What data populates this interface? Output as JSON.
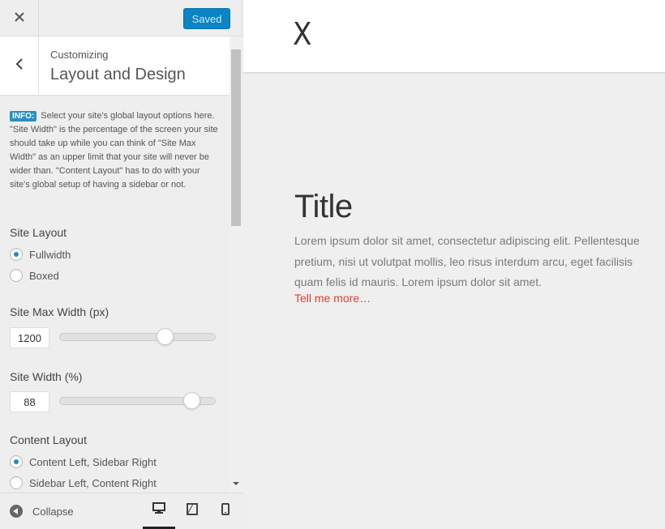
{
  "topbar": {
    "save_label": "Saved"
  },
  "section": {
    "parent_label": "Customizing",
    "title": "Layout and Design"
  },
  "info": {
    "badge": "INFO:",
    "text": "Select your site's global layout options here. \"Site Width\" is the percentage of the screen your site should take up while you can think of \"Site Max Width\" as an upper limit that your site will never be wider than. \"Content Layout\" has to do with your site's global setup of having a sidebar or not."
  },
  "site_layout": {
    "label": "Site Layout",
    "options": [
      "Fullwidth",
      "Boxed"
    ],
    "selected": "Fullwidth"
  },
  "site_max_width": {
    "label": "Site Max Width (px)",
    "value": "1200",
    "slider_fraction": 0.7
  },
  "site_width": {
    "label": "Site Width (%)",
    "value": "88",
    "slider_fraction": 0.89
  },
  "content_layout": {
    "label": "Content Layout",
    "options": [
      "Content Left, Sidebar Right",
      "Sidebar Left, Content Right"
    ],
    "selected": "Content Left, Sidebar Right"
  },
  "footer": {
    "collapse_label": "Collapse",
    "devices": [
      "desktop-icon",
      "tablet-icon",
      "mobile-icon"
    ],
    "active_device": "desktop"
  },
  "preview": {
    "logo": "X",
    "post_title": "Title",
    "post_body": "Lorem ipsum dolor sit amet, consectetur adipiscing elit. Pellentesque pretium, nisi ut volutpat mollis, leo risus interdum arcu, eget facilisis quam felis id mauris. Lorem ipsum dolor sit amet.",
    "read_more": "Tell me more…"
  },
  "colors": {
    "accent": "#0a84c2",
    "link": "#e13d2b",
    "panel_bg": "#eeeeee"
  }
}
